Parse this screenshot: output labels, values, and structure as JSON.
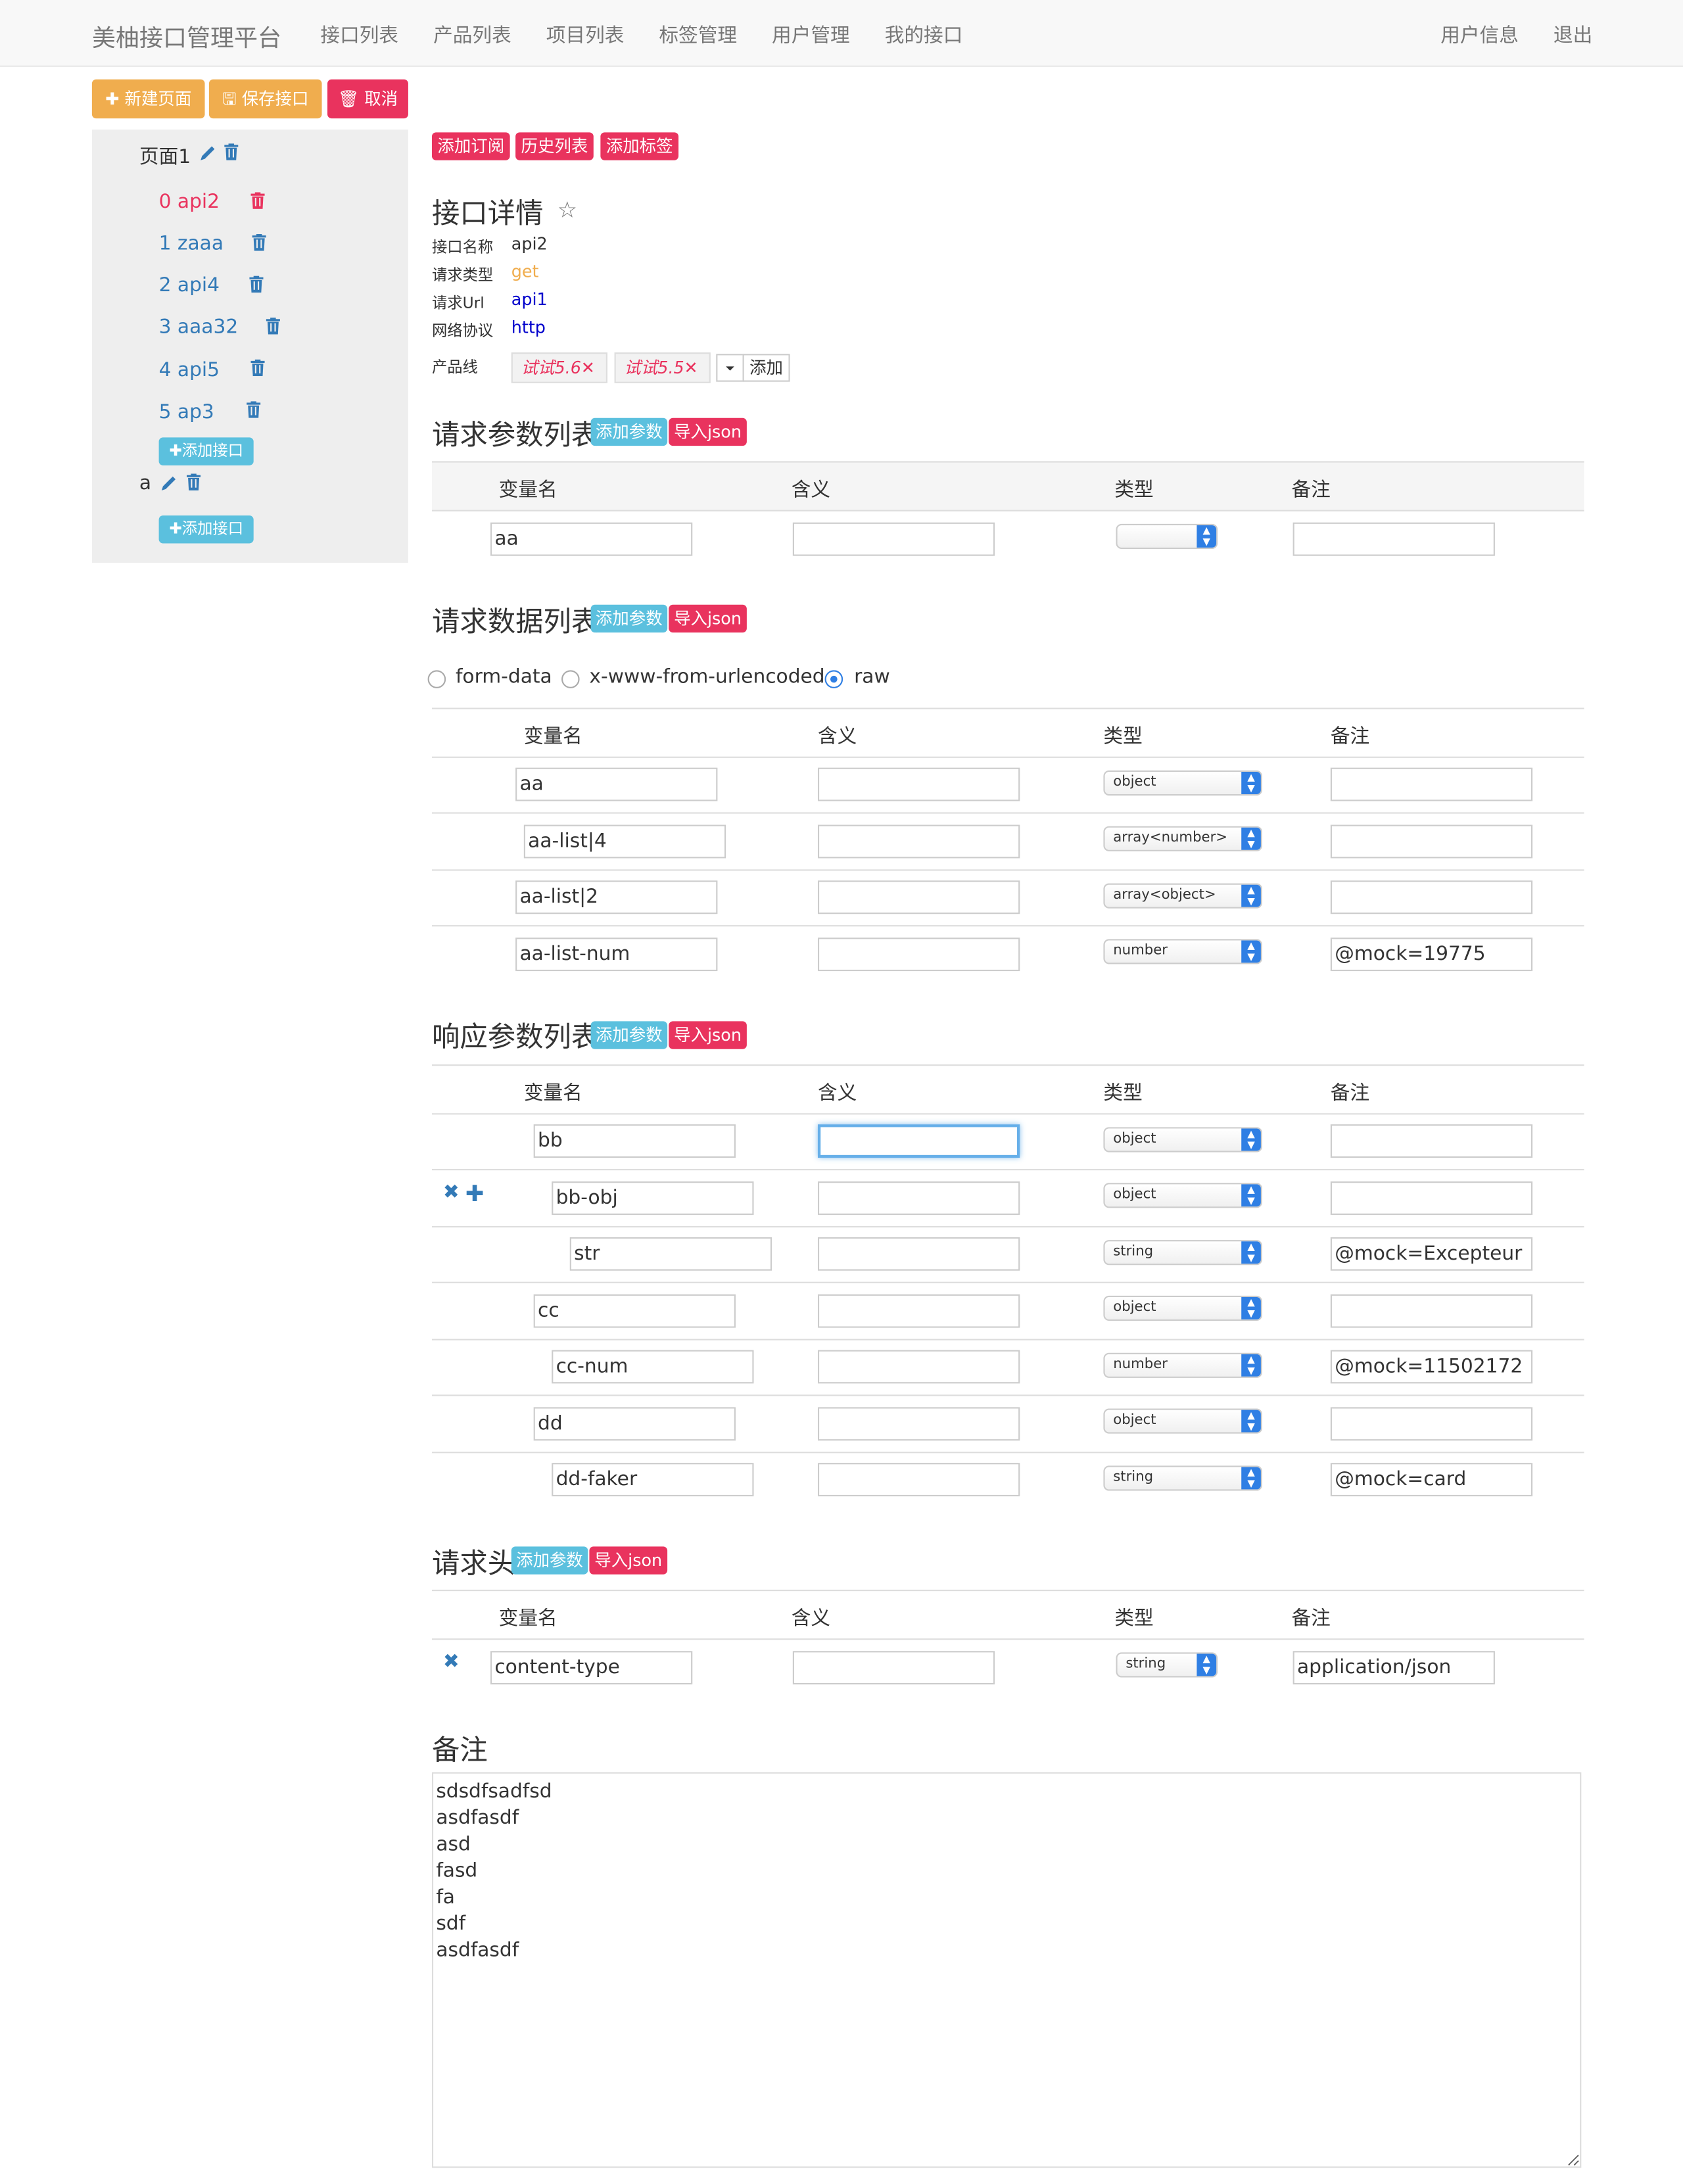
{
  "navbar": {
    "brand": "美柚接口管理平台",
    "items": [
      "接口列表",
      "产品列表",
      "项目列表",
      "标签管理",
      "用户管理",
      "我的接口"
    ],
    "right": [
      "用户信息",
      "退出"
    ]
  },
  "toolbar": {
    "new_page": "✚ 新建页面",
    "save": "🖫 保存接口",
    "cancel": "🗑 取消"
  },
  "sidebar": {
    "pages": [
      {
        "name": "页面1",
        "apis": [
          "0 api2",
          "1 zaaa",
          "2 api4",
          "3 aaa32",
          "4 api5",
          "5 ap3"
        ],
        "add_api": "✚添加接口"
      },
      {
        "name": "a",
        "apis": [],
        "add_api": "✚添加接口"
      }
    ]
  },
  "actions": [
    "添加订阅",
    "历史列表",
    "添加标签"
  ],
  "detail": {
    "title": "接口详情",
    "star": "☆",
    "fields": [
      {
        "label": "接口名称",
        "value": "api2",
        "color": "#333333"
      },
      {
        "label": "请求类型",
        "value": "get",
        "color": "#f0ad4e"
      },
      {
        "label": "请求Url",
        "value": "api1",
        "color": "#0000cc"
      },
      {
        "label": "网络协议",
        "value": "http",
        "color": "#0000cc"
      }
    ],
    "product_line_label": "产品线",
    "product_tags": [
      "试试5.6",
      "试试5.5"
    ],
    "add_label": "添加"
  },
  "common": {
    "add_param": "添加参数",
    "import_json": "导入json",
    "col_name": "变量名",
    "col_meaning": "含义",
    "col_type": "类型",
    "col_note": "备注"
  },
  "request_params": {
    "title": "请求参数列表",
    "rows": [
      {
        "name": "aa",
        "meaning": "",
        "type": "",
        "note": ""
      }
    ]
  },
  "request_data": {
    "title": "请求数据列表",
    "body_types": [
      "form-data",
      "x-www-from-urlencoded",
      "raw"
    ],
    "selected_body_type": "raw",
    "rows": [
      {
        "name": "aa",
        "meaning": "",
        "type": "object",
        "note": ""
      },
      {
        "name": "aa-list|4",
        "meaning": "",
        "type": "array<number>",
        "note": ""
      },
      {
        "name": "aa-list|2",
        "meaning": "",
        "type": "array<object>",
        "note": ""
      },
      {
        "name": "aa-list-num",
        "meaning": "",
        "type": "number",
        "note": "@mock=19775"
      }
    ]
  },
  "response_params": {
    "title": "响应参数列表",
    "rows": [
      {
        "name": "bb",
        "meaning": "",
        "type": "object",
        "note": ""
      },
      {
        "name": "bb-obj",
        "meaning": "",
        "type": "object",
        "note": ""
      },
      {
        "name": "str",
        "meaning": "",
        "type": "string",
        "note": "@mock=Excepteur"
      },
      {
        "name": "cc",
        "meaning": "",
        "type": "object",
        "note": ""
      },
      {
        "name": "cc-num",
        "meaning": "",
        "type": "number",
        "note": "@mock=11502172"
      },
      {
        "name": "dd",
        "meaning": "",
        "type": "object",
        "note": ""
      },
      {
        "name": "dd-faker",
        "meaning": "",
        "type": "string",
        "note": "@mock=card"
      }
    ]
  },
  "request_headers": {
    "title": "请求头",
    "rows": [
      {
        "name": "content-type",
        "meaning": "",
        "type": "string",
        "note": "application/json"
      }
    ]
  },
  "notes": {
    "title": "备注",
    "content": "sdsdfsadfsd\nasdfasdf\nasd\nfasd\nfa\nsdf\nasdfasdf"
  }
}
